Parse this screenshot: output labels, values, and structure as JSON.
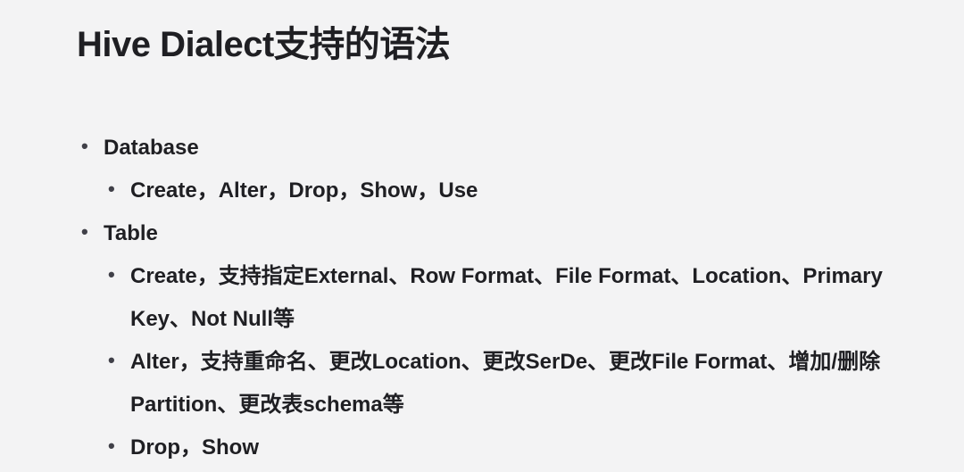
{
  "title": "Hive Dialect支持的语法",
  "items": [
    {
      "label": "Database",
      "children": [
        {
          "label": "Create，Alter，Drop，Show，Use"
        }
      ]
    },
    {
      "label": "Table",
      "children": [
        {
          "label": "Create，支持指定External、Row Format、File Format、Location、Primary Key、Not Null等"
        },
        {
          "label": "Alter，支持重命名、更改Location、更改SerDe、更改File Format、增加/删除Partition、更改表schema等"
        },
        {
          "label": "Drop，Show"
        }
      ]
    }
  ]
}
